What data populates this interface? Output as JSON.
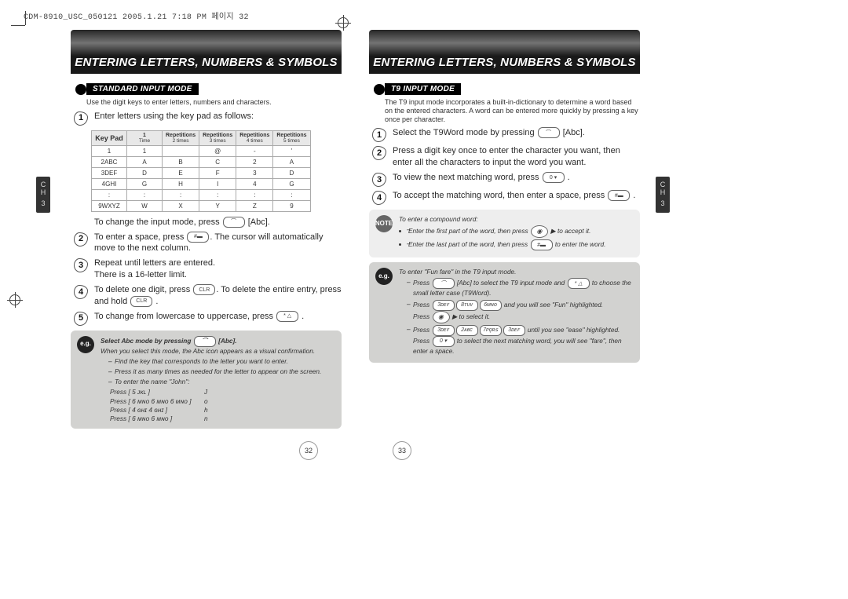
{
  "header_line": "CDM-8910_USC_050121  2005.1.21 7:18 PM  페이지 32",
  "banner_title": "ENTERING LETTERS, NUMBERS & SYMBOLS",
  "side_tab": {
    "line1": "C",
    "line2": "H",
    "line3": "3"
  },
  "page_numbers": {
    "left": "32",
    "right": "33"
  },
  "left": {
    "section": "STANDARD INPUT MODE",
    "intro": "Use the digit keys to enter letters, numbers and characters.",
    "step1": "Enter letters using the key pad as follows:",
    "keypad": {
      "col0": "Key Pad",
      "headers": [
        {
          "top": "1",
          "sub": "Time"
        },
        {
          "top": "Repetitions",
          "sub": "2 times"
        },
        {
          "top": "Repetitions",
          "sub": "3 times"
        },
        {
          "top": "Repetitions",
          "sub": "4 times"
        },
        {
          "top": "Repetitions",
          "sub": "5 times"
        }
      ],
      "rows": [
        [
          "1",
          "1",
          "",
          "@",
          "-",
          "'"
        ],
        [
          "2ABC",
          "A",
          "B",
          "C",
          "2",
          "A"
        ],
        [
          "3DEF",
          "D",
          "E",
          "F",
          "3",
          "D"
        ],
        [
          "4GHI",
          "G",
          "H",
          "I",
          "4",
          "G"
        ],
        [
          ":",
          ":",
          ":",
          ":",
          ":",
          ":"
        ],
        [
          "9WXYZ",
          "W",
          "X",
          "Y",
          "Z",
          "9"
        ]
      ]
    },
    "post_table": "To change the input mode, press",
    "post_table_label": "[Abc].",
    "step2a": "To enter a space, press",
    "step2b": ". The cursor will automatically move to the next column.",
    "step3": "Repeat until letters are entered.\nThere is a 16-letter limit.",
    "step4a": "To delete one digit, press",
    "step4b": ". To delete the entire entry, press and hold",
    "step5a": "To change from lowercase to uppercase, press",
    "eg": {
      "title": "Select Abc mode by pressing",
      "title_label": "[Abc].",
      "line1": "When you select this mode, the Abc icon appears as a visual confirmation.",
      "b1": "Find the key that corresponds to the letter you want to enter.",
      "b2": "Press it as many times as needed for the letter to appear on the screen.",
      "b3": "To enter the name \"John\":",
      "rows": [
        {
          "k": "Press [ 5 ᴊᴋʟ ]",
          "v": "J"
        },
        {
          "k": "Press [ 6 ᴍɴᴏ 6 ᴍɴᴏ 6 ᴍɴᴏ ]",
          "v": "o"
        },
        {
          "k": "Press [ 4 ɢʜɪ 4 ɢʜɪ ]",
          "v": "h"
        },
        {
          "k": "Press [ 6 ᴍɴᴏ 6 ᴍɴᴏ ]",
          "v": "n"
        }
      ]
    }
  },
  "right": {
    "section": "T9 INPUT MODE",
    "intro": "The T9 input mode incorporates a built-in-dictionary to determine a word based on the entered characters. A word can be entered more quickly by pressing a key once per character.",
    "step1a": "Select the T9Word mode by pressing",
    "step1b": "[Abc].",
    "step2": "Press a digit key once to enter the character you want, then enter all the characters to input the word you want.",
    "step3a": "To view the next matching word, press",
    "step4a": "To accept the matching word, then enter a space, press",
    "note": {
      "title": "To enter a compound word:",
      "b1": "Enter the first part of the word, then press",
      "b1_end": "to accept it.",
      "b2": "Enter the last part of the word, then press",
      "b2_end": "to enter the word."
    },
    "eg": {
      "title": "To enter \"Fun fare\" in the T9 input mode.",
      "l1a": "Press",
      "l1b": "[Abc] to select the T9 input mode and",
      "l1c": "to choose the small letter case (T9Word).",
      "l2a": "Press",
      "l2b": "and you will see \"Fun\" highlighted.",
      "l2c": "Press",
      "l2d": "to select it.",
      "l3a": "Press",
      "l3b": "until you see \"ease\" highlighted.",
      "l3c": "Press",
      "l3d": "to select the next matching word, you will see \"fare\", then enter a space."
    }
  }
}
